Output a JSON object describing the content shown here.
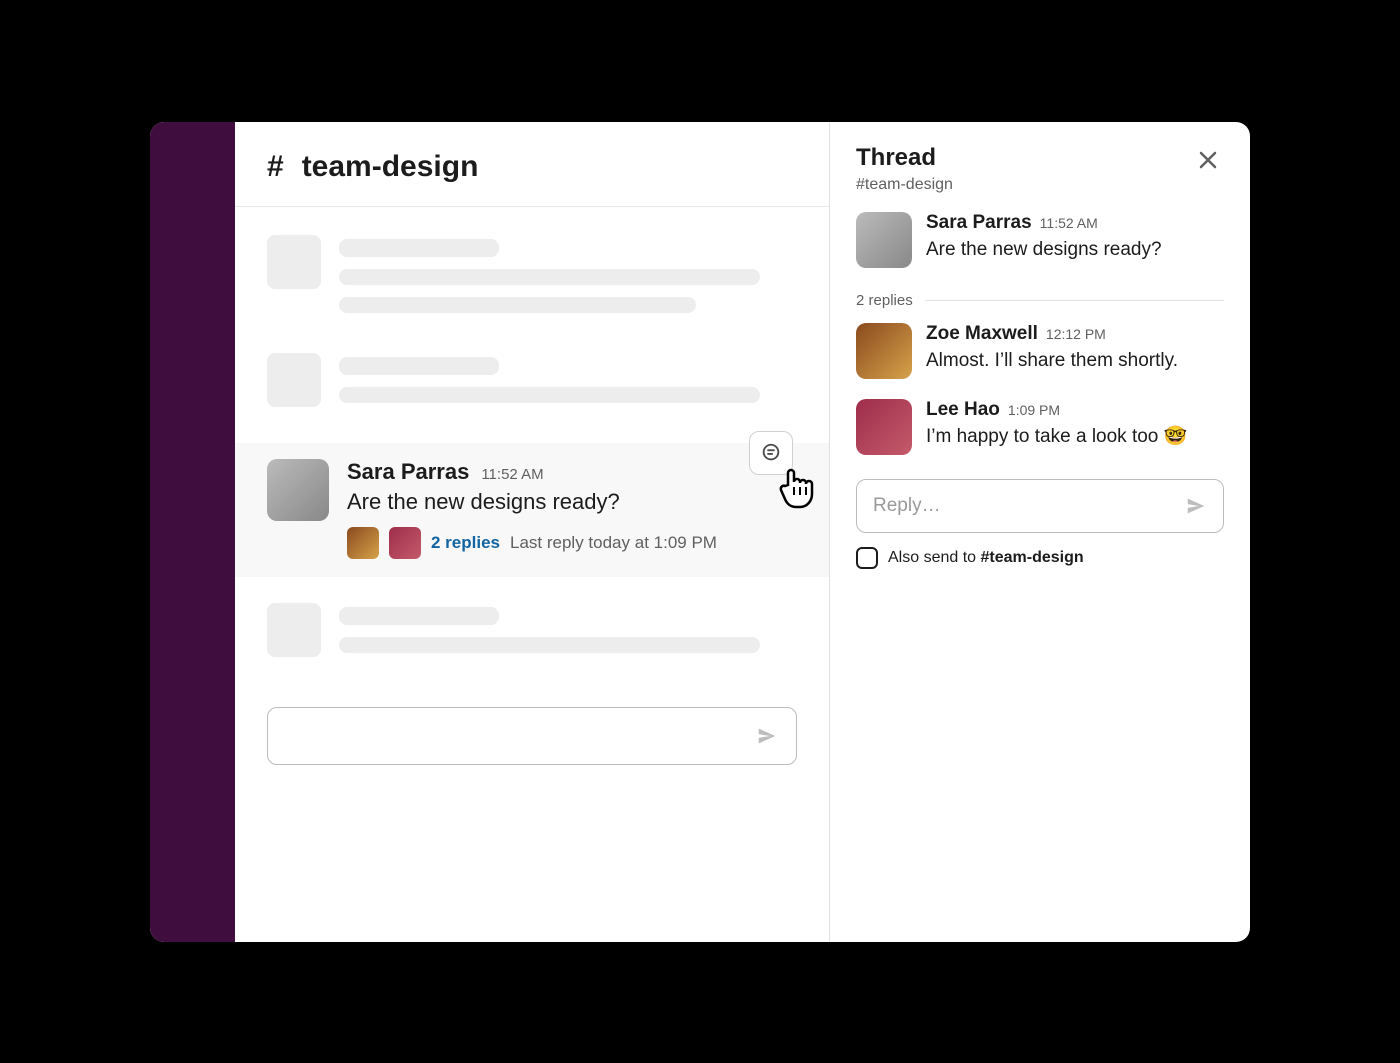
{
  "channel": {
    "hash": "#",
    "name": "team-design"
  },
  "message": {
    "author": "Sara Parras",
    "timestamp": "11:52 AM",
    "text": "Are the new designs ready?",
    "reply_count": "2 replies",
    "last_reply": "Last reply today at 1:09 PM"
  },
  "thread": {
    "title": "Thread",
    "subtitle": "#team-design",
    "parent": {
      "author": "Sara Parras",
      "timestamp": "11:52 AM",
      "text": "Are the new designs ready?"
    },
    "replies_label": "2 replies",
    "replies": [
      {
        "author": "Zoe Maxwell",
        "timestamp": "12:12 PM",
        "text": "Almost. I’ll share them shortly."
      },
      {
        "author": "Lee Hao",
        "timestamp": "1:09 PM",
        "text": "I’m happy to take a look too 🤓"
      }
    ],
    "reply_placeholder": "Reply…",
    "also_send_prefix": "Also send to ",
    "also_send_channel": "#team-design"
  }
}
